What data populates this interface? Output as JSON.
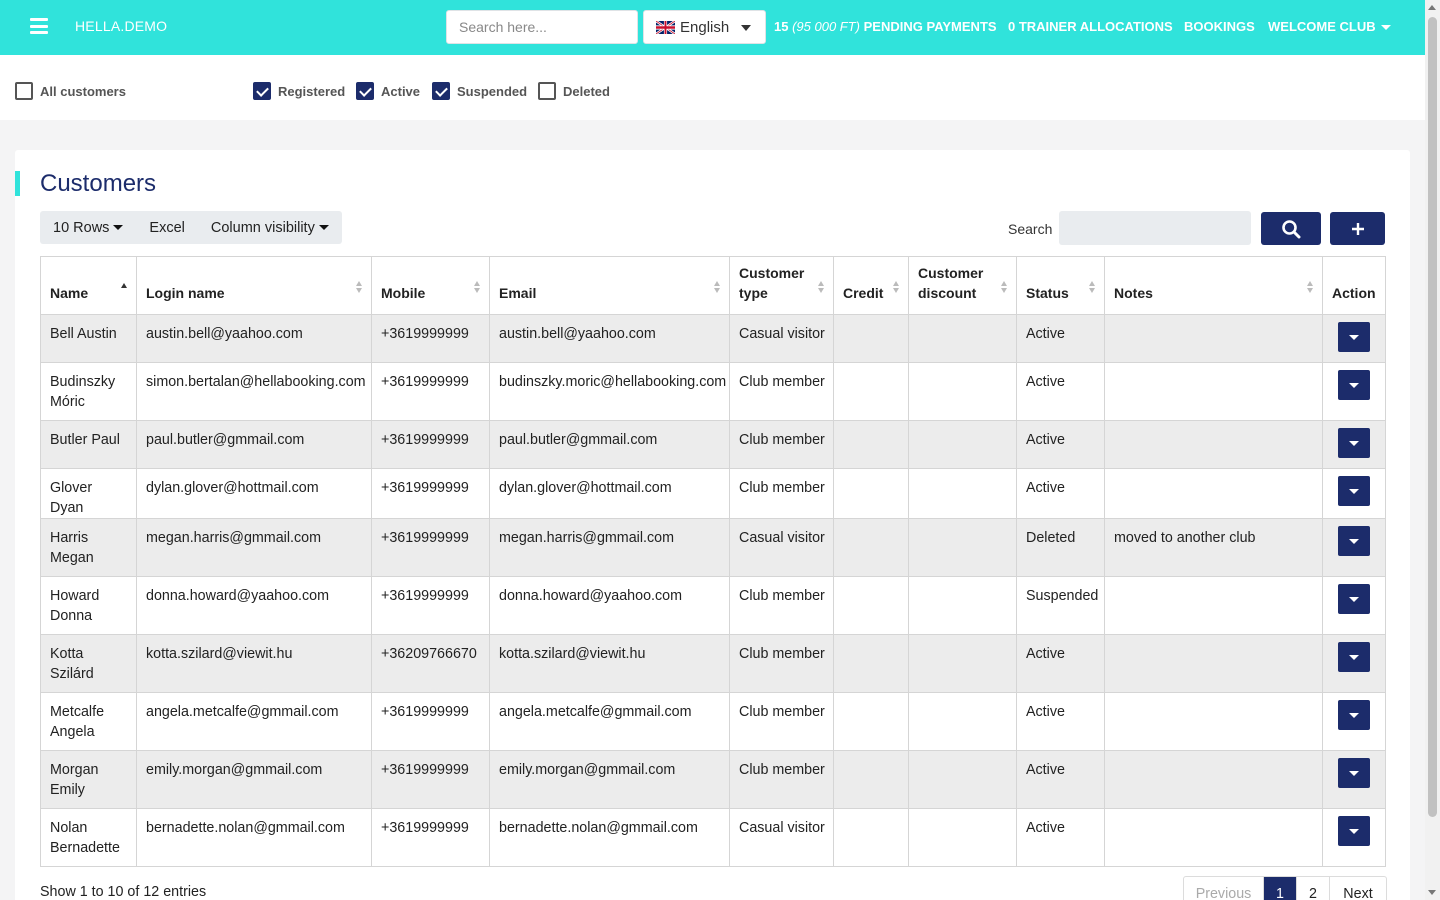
{
  "header": {
    "brand": "HELLA.DEMO",
    "search_placeholder": "Search here...",
    "language": "English",
    "payments_count": "15",
    "payments_amount": "(95 000 FT)",
    "payments_label": "PENDING PAYMENTS",
    "trainer_allocations": "0 TRAINER ALLOCATIONS",
    "bookings": "BOOKINGS",
    "club": "WELCOME CLUB"
  },
  "filters": [
    {
      "label": "All customers",
      "checked": false
    },
    {
      "label": "Registered",
      "checked": true
    },
    {
      "label": "Active",
      "checked": true
    },
    {
      "label": "Suspended",
      "checked": true
    },
    {
      "label": "Deleted",
      "checked": false
    }
  ],
  "page": {
    "title": "Customers",
    "rows_button": "10 Rows",
    "excel_button": "Excel",
    "colvis_button": "Column visibility",
    "search_label": "Search"
  },
  "table": {
    "headers": [
      "Name",
      "Login name",
      "Mobile",
      "Email",
      "Customer type",
      "Credit",
      "Customer discount",
      "Status",
      "Notes",
      "Action"
    ],
    "rows": [
      {
        "name": "Bell Austin",
        "login": "austin.bell@yaahoo.com",
        "mobile": "+3619999999",
        "email": "austin.bell@yaahoo.com",
        "type": "Casual visitor",
        "credit": "",
        "discount": "",
        "status": "Active",
        "notes": ""
      },
      {
        "name": "Budinszky Móric",
        "login": "simon.bertalan@hellabooking.com",
        "mobile": "+3619999999",
        "email": "budinszky.moric@hellabooking.com",
        "type": "Club member",
        "credit": "",
        "discount": "",
        "status": "Active",
        "notes": ""
      },
      {
        "name": "Butler Paul",
        "login": "paul.butler@gmmail.com",
        "mobile": "+3619999999",
        "email": "paul.butler@gmmail.com",
        "type": "Club member",
        "credit": "",
        "discount": "",
        "status": "Active",
        "notes": ""
      },
      {
        "name": "Glover Dyan",
        "login": "dylan.glover@hottmail.com",
        "mobile": "+3619999999",
        "email": "dylan.glover@hottmail.com",
        "type": "Club member",
        "credit": "",
        "discount": "",
        "status": "Active",
        "notes": ""
      },
      {
        "name": "Harris Megan",
        "login": "megan.harris@gmmail.com",
        "mobile": "+3619999999",
        "email": "megan.harris@gmmail.com",
        "type": "Casual visitor",
        "credit": "",
        "discount": "",
        "status": "Deleted",
        "notes": "moved to another club"
      },
      {
        "name": "Howard Donna",
        "login": "donna.howard@yaahoo.com",
        "mobile": "+3619999999",
        "email": "donna.howard@yaahoo.com",
        "type": "Club member",
        "credit": "",
        "discount": "",
        "status": "Suspended",
        "notes": ""
      },
      {
        "name": "Kotta Szilárd",
        "login": "kotta.szilard@viewit.hu",
        "mobile": "+36209766670",
        "email": "kotta.szilard@viewit.hu",
        "type": "Club member",
        "credit": "",
        "discount": "",
        "status": "Active",
        "notes": ""
      },
      {
        "name": "Metcalfe Angela",
        "login": "angela.metcalfe@gmmail.com",
        "mobile": "+3619999999",
        "email": "angela.metcalfe@gmmail.com",
        "type": "Club member",
        "credit": "",
        "discount": "",
        "status": "Active",
        "notes": ""
      },
      {
        "name": "Morgan Emily",
        "login": "emily.morgan@gmmail.com",
        "mobile": "+3619999999",
        "email": "emily.morgan@gmmail.com",
        "type": "Club member",
        "credit": "",
        "discount": "",
        "status": "Active",
        "notes": ""
      },
      {
        "name": "Nolan Bernadette",
        "login": "bernadette.nolan@gmmail.com",
        "mobile": "+3619999999",
        "email": "bernadette.nolan@gmmail.com",
        "type": "Casual visitor",
        "credit": "",
        "discount": "",
        "status": "Active",
        "notes": ""
      }
    ]
  },
  "footer": {
    "info": "Show 1 to 10 of 12 entries",
    "previous": "Previous",
    "page1": "1",
    "page2": "2",
    "next": "Next"
  },
  "colors": {
    "accent": "#30e3db",
    "navy": "#1c2c6b"
  }
}
